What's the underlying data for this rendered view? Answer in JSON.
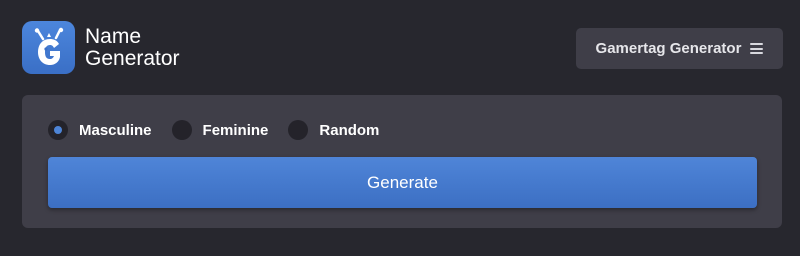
{
  "header": {
    "logo_icon": "g-monster-logo-icon",
    "title_line1": "Name",
    "title_line2": "Generator",
    "menu_label": "Gamertag Generator",
    "menu_icon": "hamburger-icon"
  },
  "form": {
    "options": [
      {
        "label": "Masculine",
        "checked": true
      },
      {
        "label": "Feminine",
        "checked": false
      },
      {
        "label": "Random",
        "checked": false
      }
    ],
    "generate_label": "Generate"
  },
  "colors": {
    "background": "#27272e",
    "panel": "#3f3e48",
    "accent": "#4d84d6",
    "radio_bg": "#24232a"
  }
}
